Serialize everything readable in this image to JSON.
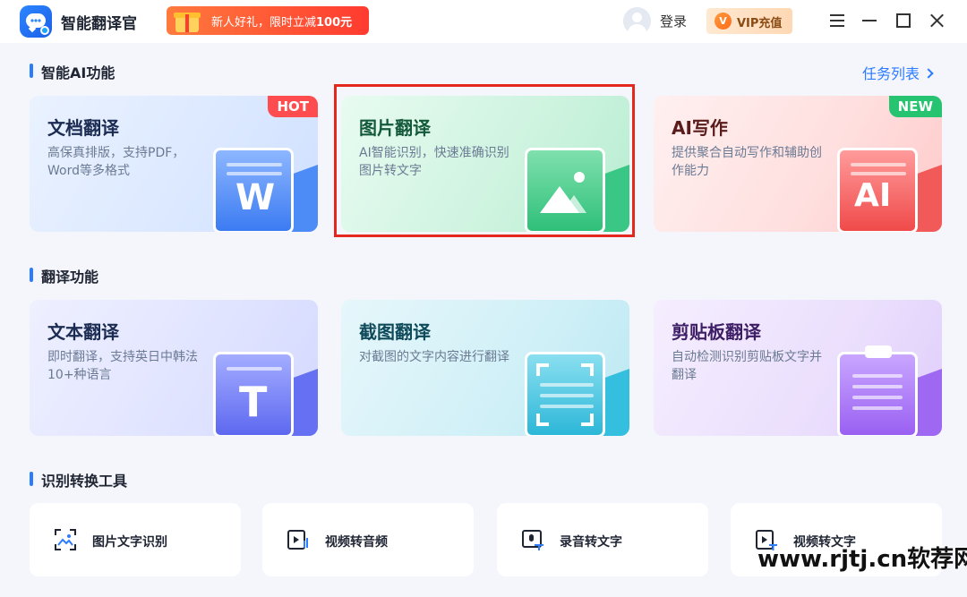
{
  "app": {
    "name": "智能翻译官"
  },
  "promo": {
    "prefix": "新人好礼，限时立减",
    "amount": "100元"
  },
  "header": {
    "login_label": "登录",
    "vip_label": "VIP充值",
    "vip_icon": "V"
  },
  "sections": {
    "ai": {
      "title": "智能AI功能",
      "task_link": "任务列表"
    },
    "translate": {
      "title": "翻译功能"
    },
    "tools": {
      "title": "识别转换工具"
    }
  },
  "cards": {
    "doc": {
      "title": "文档翻译",
      "desc": "高保真排版，支持PDF，Word等多格式",
      "tag": "HOT",
      "glyph": "W"
    },
    "img": {
      "title": "图片翻译",
      "desc": "AI智能识别，快速准确识别图片转文字"
    },
    "ai": {
      "title": "AI写作",
      "desc": "提供聚合自动写作和辅助创作能力",
      "tag": "NEW",
      "glyph": "AI"
    },
    "text": {
      "title": "文本翻译",
      "desc": "即时翻译，支持英日中韩法10+种语言",
      "glyph": "T"
    },
    "shot": {
      "title": "截图翻译",
      "desc": "对截图的文字内容进行翻译"
    },
    "clip": {
      "title": "剪贴板翻译",
      "desc": "自动检测识别剪贴板文字并翻译"
    }
  },
  "tools": [
    {
      "label": "图片文字识别",
      "icon": "image-scan-icon"
    },
    {
      "label": "视频转音频",
      "icon": "video-audio-icon"
    },
    {
      "label": "录音转文字",
      "icon": "record-text-icon"
    },
    {
      "label": "视频转文字",
      "icon": "video-text-icon"
    }
  ],
  "watermark": "www.rjtj.cn软荐网",
  "colors": {
    "accent": "#2c7cff",
    "highlight": "#e5281e",
    "hot": "#ff4d4f",
    "new": "#26c470"
  }
}
